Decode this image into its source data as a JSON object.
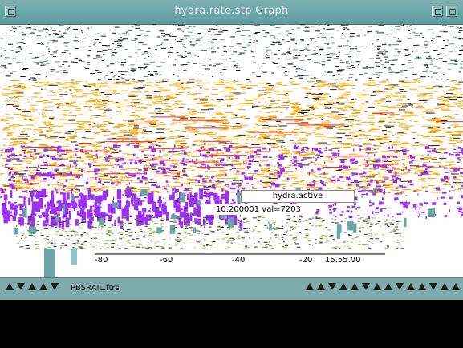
{
  "window": {
    "title": "hydra.rate.stp Graph"
  },
  "legend": {
    "active_label": "hydra.active",
    "readout": "10.200001 val=7203"
  },
  "axis": {
    "ticks": [
      "-80",
      "-60",
      "-40",
      "-20",
      "15.55.00"
    ]
  },
  "toolbar": {
    "label": "PBSRAIL.ftrs"
  },
  "colors": {
    "orange": "#ffa500",
    "purple": "#9a32f0",
    "green": "#8fbf3f",
    "teal": "#6aa6a6",
    "red": "#ff2020"
  }
}
